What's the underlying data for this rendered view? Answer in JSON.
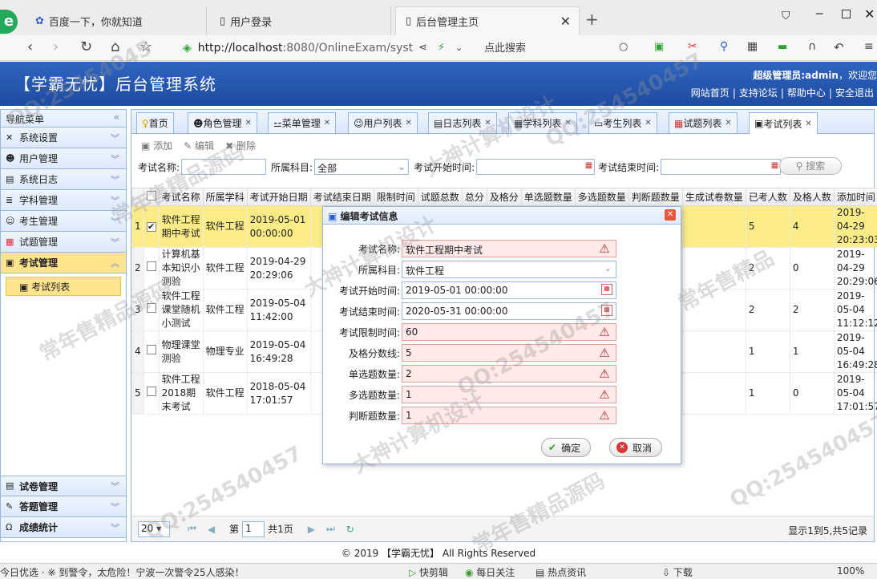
{
  "browser": {
    "tabs": [
      {
        "label": "百度一下，你就知道",
        "active": false
      },
      {
        "label": "用户登录",
        "active": false
      },
      {
        "label": "后台管理主页",
        "active": true
      }
    ],
    "url_host": "http://localhost",
    "url_rest": ":8080/OnlineExam/syst",
    "search_placeholder": "点此搜索"
  },
  "header": {
    "title": "【学霸无忧】后台管理系统",
    "welcome_user": "超级管理员:admin",
    "welcome_suffix": "，欢迎您",
    "links": [
      "网站首页",
      "支持论坛",
      "帮助中心",
      "安全退出"
    ]
  },
  "sidebar": {
    "title": "导航菜单",
    "items": [
      {
        "label": "系统设置",
        "icon": "settings-icon"
      },
      {
        "label": "用户管理",
        "icon": "users-icon"
      },
      {
        "label": "系统日志",
        "icon": "log-icon"
      },
      {
        "label": "学科管理",
        "icon": "subject-icon"
      },
      {
        "label": "考生管理",
        "icon": "students-icon"
      },
      {
        "label": "试题管理",
        "icon": "calendar-icon"
      },
      {
        "label": "考试管理",
        "icon": "exam-icon"
      }
    ],
    "sub_item": "考试列表",
    "bottom_items": [
      {
        "label": "试卷管理",
        "icon": "paper-icon"
      },
      {
        "label": "答题管理",
        "icon": "answer-icon"
      },
      {
        "label": "成绩统计",
        "icon": "stats-icon"
      }
    ]
  },
  "main_tabs": [
    "首页",
    "角色管理",
    "菜单管理",
    "用户列表",
    "日志列表",
    "学科列表",
    "考生列表",
    "试题列表",
    "考试列表"
  ],
  "toolbar": {
    "add": "添加",
    "edit": "编辑",
    "delete": "删除"
  },
  "filters": {
    "name_label": "考试名称:",
    "subject_label": "所属科目:",
    "subject_value": "全部",
    "start_label": "考试开始时间:",
    "end_label": "考试结束时间:",
    "search_button": "搜索"
  },
  "grid": {
    "columns": [
      "考试名称",
      "所属学科",
      "考试开始日期",
      "考试结束日期",
      "限制时间",
      "试题总数",
      "总分",
      "及格分",
      "单选题数量",
      "多选题数量",
      "判断题数量",
      "生成试卷数量",
      "已考人数",
      "及格人数",
      "添加时间"
    ],
    "rows": [
      {
        "num": "1",
        "checked": true,
        "name": "软件工程期中考试",
        "subject": "软件工程",
        "start": "2019-05-01 00:00:00",
        "taken": "5",
        "passed": "4",
        "added": "2019-04-29 20:23:03"
      },
      {
        "num": "2",
        "checked": false,
        "name": "计算机基本知识小测验",
        "subject": "软件工程",
        "start": "2019-04-29 20:29:06",
        "taken": "2",
        "passed": "0",
        "added": "2019-04-29 20:29:06"
      },
      {
        "num": "3",
        "checked": false,
        "name": "软件工程课堂随机小测试",
        "subject": "软件工程",
        "start": "2019-05-04 11:42:00",
        "taken": "2",
        "passed": "2",
        "added": "2019-05-04 11:12:12"
      },
      {
        "num": "4",
        "checked": false,
        "name": "物理课堂测验",
        "subject": "物理专业",
        "start": "2019-05-04 16:49:28",
        "taken": "1",
        "passed": "1",
        "added": "2019-05-04 16:49:28"
      },
      {
        "num": "5",
        "checked": false,
        "name": "软件工程2018期末考试",
        "subject": "软件工程",
        "start": "2018-05-04 17:01:57",
        "taken": "1",
        "passed": "0",
        "added": "2019-05-04 17:01:57"
      }
    ]
  },
  "pager": {
    "size": "20",
    "page_label": "第",
    "page": "1",
    "total_pages": "共1页",
    "info": "显示1到5,共5记录"
  },
  "dialog": {
    "title": "编辑考试信息",
    "fields": [
      {
        "label": "考试名称:",
        "value": "软件工程期中考试",
        "kind": "warn"
      },
      {
        "label": "所属科目:",
        "value": "软件工程",
        "kind": "select"
      },
      {
        "label": "考试开始时间:",
        "value": "2019-05-01 00:00:00",
        "kind": "date"
      },
      {
        "label": "考试结束时间:",
        "value": "2020-05-31 00:00:00",
        "kind": "date"
      },
      {
        "label": "考试限制时间:",
        "value": "60",
        "kind": "warn"
      },
      {
        "label": "及格分数线:",
        "value": "5",
        "kind": "warn"
      },
      {
        "label": "单选题数量:",
        "value": "2",
        "kind": "warn"
      },
      {
        "label": "多选题数量:",
        "value": "1",
        "kind": "warn"
      },
      {
        "label": "判断题数量:",
        "value": "1",
        "kind": "warn"
      }
    ],
    "ok": "确定",
    "cancel": "取消"
  },
  "footer": "© 2019 【学霸无忧】 All Rights Reserved",
  "statusbar": {
    "left": "今日优选  ·  ※ 到警令，太危险！宁波一次警令25人感染！",
    "items": [
      "快剪辑",
      "每日关注",
      "热点资讯",
      "下载",
      "100%"
    ]
  },
  "watermarks": [
    "QQ:25454045",
    "常年售精品源码",
    "大神计算机设计",
    "QQ:254540457",
    "常年售精品源码",
    "大神计算机设计",
    "QQ:254540457",
    "常年售精品",
    "QQ:254540457",
    "常年售精品源码",
    "QQ:254540457",
    "大神计算机设计"
  ]
}
